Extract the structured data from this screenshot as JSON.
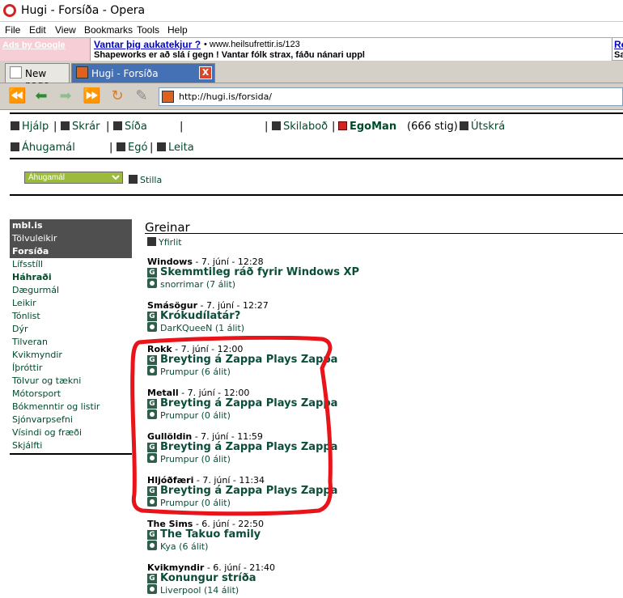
{
  "window": {
    "title": "Hugi - Forsíða - Opera"
  },
  "menu": [
    "File",
    "Edit",
    "View",
    "Bookmarks",
    "Tools",
    "Help"
  ],
  "ads": {
    "label": "Ads by Google",
    "title": "Vantar þig aukatekjur ?",
    "url": "• www.heilsufrettir.is/123",
    "description": "Shapeworks er að slá í gegn ! Vantar fólk strax, fáðu nánari uppl",
    "right_title": "Re",
    "right_desc": "Sa"
  },
  "tabs": [
    {
      "label": "New page"
    },
    {
      "label": "Hugi - Forsíða",
      "close": "X"
    }
  ],
  "address": {
    "url": "http://hugi.is/forsida/"
  },
  "nav": {
    "help": "Hjálp",
    "register": "Skrár",
    "page": "Síða",
    "messages": "Skilaboð",
    "user": "EgoMan",
    "points": "(666 stig)",
    "logout": "Útskrá",
    "interests": "Áhugamál",
    "ego": "Egó",
    "search": "Leita",
    "select_value": "Áhugamál",
    "apply": "Stilla"
  },
  "sidebar": [
    {
      "label": "mbl.is",
      "style": "dark-bold"
    },
    {
      "label": "Tölvuleikir",
      "style": "dark"
    },
    {
      "label": "Forsíða",
      "style": "dark-bold"
    },
    {
      "label": "Lífsstíll"
    },
    {
      "label": "Háhraði",
      "style": "bold"
    },
    {
      "label": "Dægurmál"
    },
    {
      "label": "Leikir"
    },
    {
      "label": "Tónlist"
    },
    {
      "label": "Dýr"
    },
    {
      "label": "Tilveran"
    },
    {
      "label": "Kvikmyndir"
    },
    {
      "label": "Íþróttir"
    },
    {
      "label": "Tölvur og tækni"
    },
    {
      "label": "Mótorsport"
    },
    {
      "label": "Bókmenntir og listir"
    },
    {
      "label": "Sjónvarpsefni"
    },
    {
      "label": "Vísindi og fræði"
    },
    {
      "label": "Skjálfti"
    }
  ],
  "main": {
    "heading": "Greinar",
    "overview": "Yfirlit",
    "articles": [
      {
        "category": "Windows",
        "date": " - 7. júní - 12:28",
        "title": "Skemmtileg ráð fyrir Windows XP",
        "meta": "snorrimar (7 álit)"
      },
      {
        "category": "Smásögur",
        "date": " - 7. júní - 12:27",
        "title": "Krókudílatár?",
        "meta": "DarKQueeN (1 álit)"
      },
      {
        "category": "Rokk",
        "date": " - 7. júní - 12:00",
        "title": "Breyting á Zappa Plays Zappa",
        "meta": "Prumpur (6 álit)"
      },
      {
        "category": "Metall",
        "date": " - 7. júní - 12:00",
        "title": "Breyting á Zappa Plays Zappa",
        "meta": "Prumpur (0 álit)"
      },
      {
        "category": "Gullöldin",
        "date": " - 7. júní - 11:59",
        "title": "Breyting á Zappa Plays Zappa",
        "meta": "Prumpur (0 álit)"
      },
      {
        "category": "Hljóðfæri",
        "date": " - 7. júní - 11:34",
        "title": "Breyting á Zappa Plays Zappa",
        "meta": "Prumpur (0 álit)"
      },
      {
        "category": "The Sims",
        "date": " - 6. júní - 22:50",
        "title": "The Takuo family",
        "meta": "Kya (6 álit)"
      },
      {
        "category": "Kvikmyndir",
        "date": " - 6. júní - 21:40",
        "title": "Konungur stríða",
        "meta": "Liverpool (14 álit)"
      }
    ]
  },
  "colors": {
    "highlight": "#e8141a",
    "link_green": "#0a4d3b",
    "tab_active": "#4470b6"
  }
}
